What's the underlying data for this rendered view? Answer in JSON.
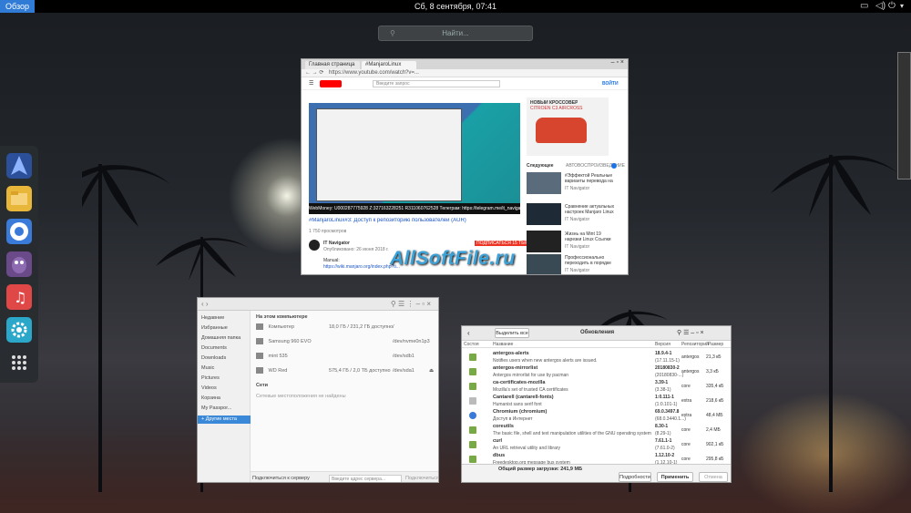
{
  "topbar": {
    "activities": "Обзор",
    "clock": "Сб, 8 сентября, 07:41"
  },
  "search": {
    "placeholder": "Найти..."
  },
  "dash": {
    "apps": [
      "antergos-icon",
      "files-icon",
      "chromium-icon",
      "pidgin-icon",
      "music-icon",
      "settings-icon",
      "app-grid-icon"
    ]
  },
  "browser": {
    "tabs": [
      "Главная страница",
      "#ManjaroLinux"
    ],
    "url": "https://www.youtube.com/watch?v=...",
    "yt_search": "Введите запрос",
    "yt_signin": "ВОЙТИ",
    "video_caption": "WebMoney: U000287775928 Z:327163228251 R311060762528 Телеграм: https://telegram.me/it_navigator",
    "video_title": "#ManjaroLinux#3: Доступ к репозиторию пользователей (AUR)",
    "views": "1 750 просмотров",
    "channel": "IT Navigator",
    "channel_date": "Опубликовано: 26 июня 2018 г.",
    "subscribe": "ПОДПИСАТЬСЯ 15 ТЫС.",
    "description": "Manual:",
    "description_link": "https://wiki.manjaro.org/index.php?ti...",
    "ad_title": "НОВЫЙ КРОССОВЕР",
    "ad_subtitle": "CITROËN C3 AIRCROSS",
    "up_next": "Следующее",
    "autoplay": "АВТОВОСПРОИЗВЕДЕНИЕ",
    "related": [
      {
        "title": "#Эффектой Реальные варианты перевода на",
        "channel": "IT Navigator"
      },
      {
        "title": "Сравнение актуальных настроек Manjaro Linux с...",
        "channel": "IT Navigator"
      },
      {
        "title": "Жизнь на Mint 19 нарезки Linux Ссылки",
        "channel": "IT Navigator"
      },
      {
        "title": "Профессионально переходить в порядке",
        "channel": "IT Navigator"
      }
    ]
  },
  "files": {
    "section_this_pc": "На этом компьютере",
    "section_network": "Сети",
    "network_empty": "Сетевые местоположения не найдены",
    "sidebar": [
      {
        "label": "Недавние",
        "active": false
      },
      {
        "label": "Избранные",
        "active": false
      },
      {
        "label": "Домашняя папка",
        "active": false
      },
      {
        "label": "Documents",
        "active": false
      },
      {
        "label": "Downloads",
        "active": false
      },
      {
        "label": "Music",
        "active": false
      },
      {
        "label": "Pictures",
        "active": false
      },
      {
        "label": "Videos",
        "active": false
      },
      {
        "label": "Корзина",
        "active": false
      },
      {
        "label": "My Passpor...",
        "active": false
      },
      {
        "label": "+ Другие места",
        "active": true
      }
    ],
    "rows": [
      {
        "name": "Компьютер",
        "info": "18,0 ГБ / 231,2 ГБ доступно",
        "path": "/"
      },
      {
        "name": "Samsung 960 EVO",
        "info": "",
        "path": "/dev/nvme0n1p3"
      },
      {
        "name": "mint 535",
        "info": "",
        "path": "/dev/sdb1"
      },
      {
        "name": "WD Red",
        "info": "575,4 ГБ / 2,0 ТБ доступно",
        "path": "/dev/sda1"
      }
    ],
    "connect_label": "Подключиться к серверу",
    "connect_placeholder": "Введите адрес сервера...",
    "connect_button": "Подключиться"
  },
  "updates": {
    "select_all": "Выделить все",
    "title": "Обновления",
    "cols": {
      "state": "Состоя",
      "name": "Название",
      "version": "Версия",
      "repo": "Репозиторий",
      "size": "Размер"
    },
    "packages": [
      {
        "name": "antergos-alerts",
        "desc": "Notifies users when new antergos alerts are issued.",
        "ver": "18.9.4-1",
        "ver_old": "(17.11.15-1)",
        "repo": "antergos",
        "size": "21,3 кБ"
      },
      {
        "name": "antergos-mirrorlist",
        "desc": "Antergos mirrorlist for use by pacman",
        "ver": "20180830-2",
        "ver_old": "(20180830-...)",
        "repo": "antergos",
        "size": "3,3 кБ"
      },
      {
        "name": "ca-certificates-mozilla",
        "desc": "Mozilla's set of trusted CA certificates",
        "ver": "3.39-1",
        "ver_old": "(3.38-1)",
        "repo": "core",
        "size": "335,4 кБ"
      },
      {
        "name": "Cantarell (cantarell-fonts)",
        "desc": "Humanist sans serif font",
        "ver": "1:0.111-1",
        "ver_old": "(1:0.101-1)",
        "repo": "extra",
        "size": "218,6 кБ"
      },
      {
        "name": "Chromium (chromium)",
        "desc": "Доступ в Интернет",
        "ver": "69.0.3497.8",
        "ver_old": "(68.0.3440.1...)",
        "repo": "extra",
        "size": "48,4 МБ"
      },
      {
        "name": "coreutils",
        "desc": "The basic file, shell and text manipulation utilities of the GNU operating system",
        "ver": "8.30-1",
        "ver_old": "(8.29-1)",
        "repo": "core",
        "size": "2,4 МБ"
      },
      {
        "name": "curl",
        "desc": "An URL retrieval utility and library",
        "ver": "7.61.1-1",
        "ver_old": "(7.61.0-2)",
        "repo": "core",
        "size": "902,1 кБ"
      },
      {
        "name": "dbus",
        "desc": "Freedesktop.org message bus system",
        "ver": "1.12.10-2",
        "ver_old": "(1.12.10-1)",
        "repo": "core",
        "size": "295,8 кБ"
      }
    ],
    "total": "Общий размер загрузки: 241,9 МБ",
    "details": "Подробности",
    "apply": "Применить",
    "cancel": "Отмена"
  },
  "watermark": "AllSoftFile.ru"
}
